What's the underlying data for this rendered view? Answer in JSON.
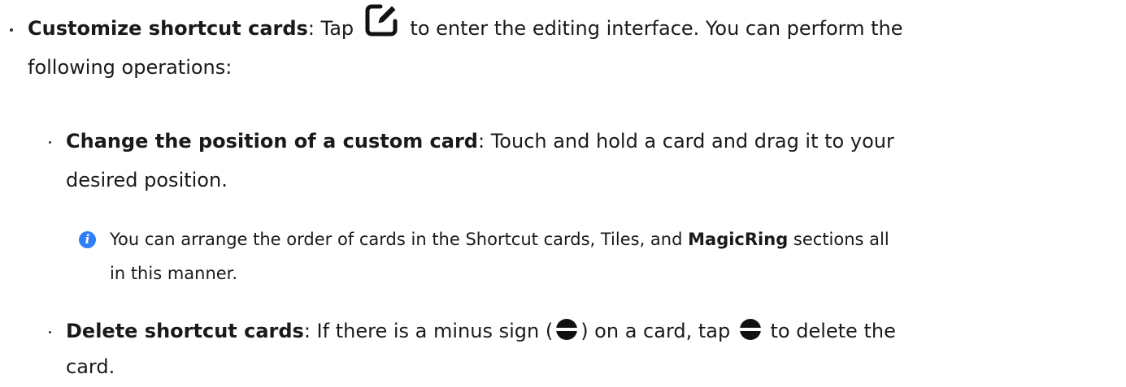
{
  "item1": {
    "title": "Customize shortcut cards",
    "text_before_icon": ": Tap ",
    "icon": "edit-icon",
    "text_after_icon": " to enter the editing interface. You can perform the",
    "line2": "following operations:"
  },
  "item2": {
    "title": "Change the position of a custom card",
    "text": ": Touch and hold a card and drag it to your",
    "line2": "desired position."
  },
  "note": {
    "icon": "info-icon",
    "icon_glyph": "i",
    "text_before_bold": "You can arrange the order of cards in the Shortcut cards, Tiles, and ",
    "bold": "MagicRing",
    "text_after_bold": " sections all",
    "line2": "in this manner."
  },
  "item3": {
    "title": "Delete shortcut cards",
    "text_before_icon1": ": If there is a minus sign (",
    "icon": "minus-circle-icon",
    "text_between_icons": ") on a card, tap ",
    "text_after_icon2": " to delete the",
    "line2": "card."
  },
  "colors": {
    "text": "#1a1a1a",
    "info_blue": "#2f7ef5",
    "icon_dark": "#111111"
  }
}
